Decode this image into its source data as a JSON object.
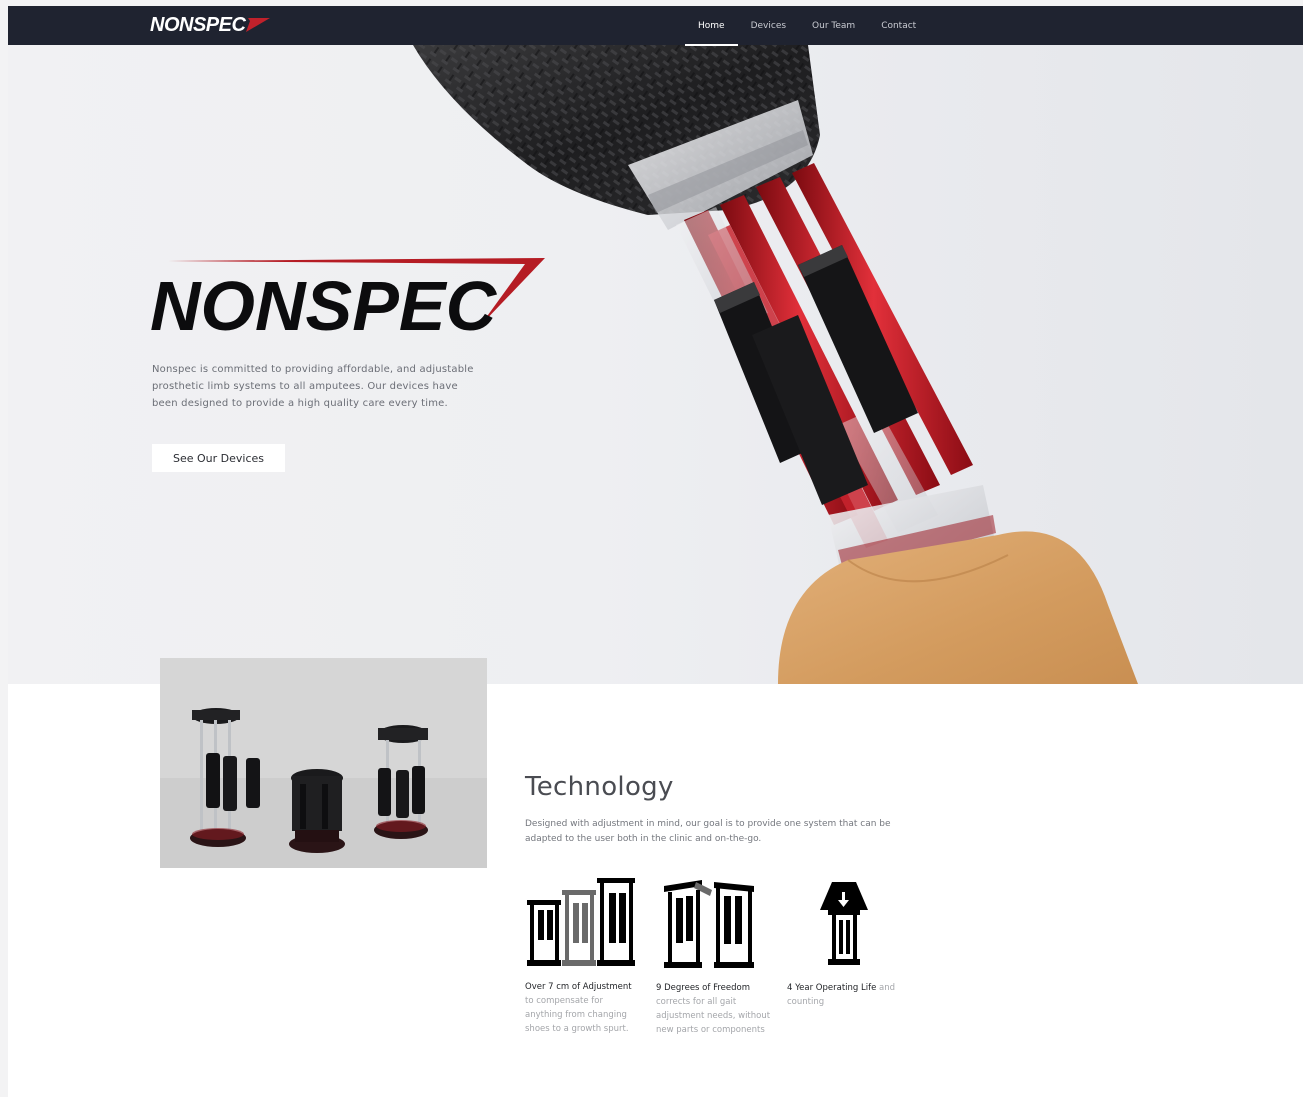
{
  "navbar": {
    "logo_text": "NONSPEC",
    "items": [
      {
        "label": "Home",
        "active": true
      },
      {
        "label": "Devices",
        "active": false
      },
      {
        "label": "Our Team",
        "active": false
      },
      {
        "label": "Contact",
        "active": false
      }
    ]
  },
  "hero": {
    "logo_text": "NONSPEC",
    "description": "Nonspec is committed to providing affordable, and adjustable prosthetic limb systems to all amputees. Our devices have been designed to provide a high quality care every time.",
    "button_label": "See Our Devices"
  },
  "technology": {
    "title": "Technology",
    "description": "Designed with adjustment in mind, our goal is to provide one system that can be adapted to the user both in the clinic and on-the-go.",
    "features": [
      {
        "title": "Over 7 cm of Adjustment",
        "text": " to compensate for anything from changing shoes to a growth spurt."
      },
      {
        "title": "9 Degrees of Freedom",
        "text": " corrects for all gait adjustment needs, without new parts or components"
      },
      {
        "title": "4 Year Operating Life",
        "text": " and counting"
      }
    ]
  },
  "colors": {
    "navbar_bg": "#1f2330",
    "accent_red": "#c0212b",
    "skin": "#d9a56a"
  }
}
